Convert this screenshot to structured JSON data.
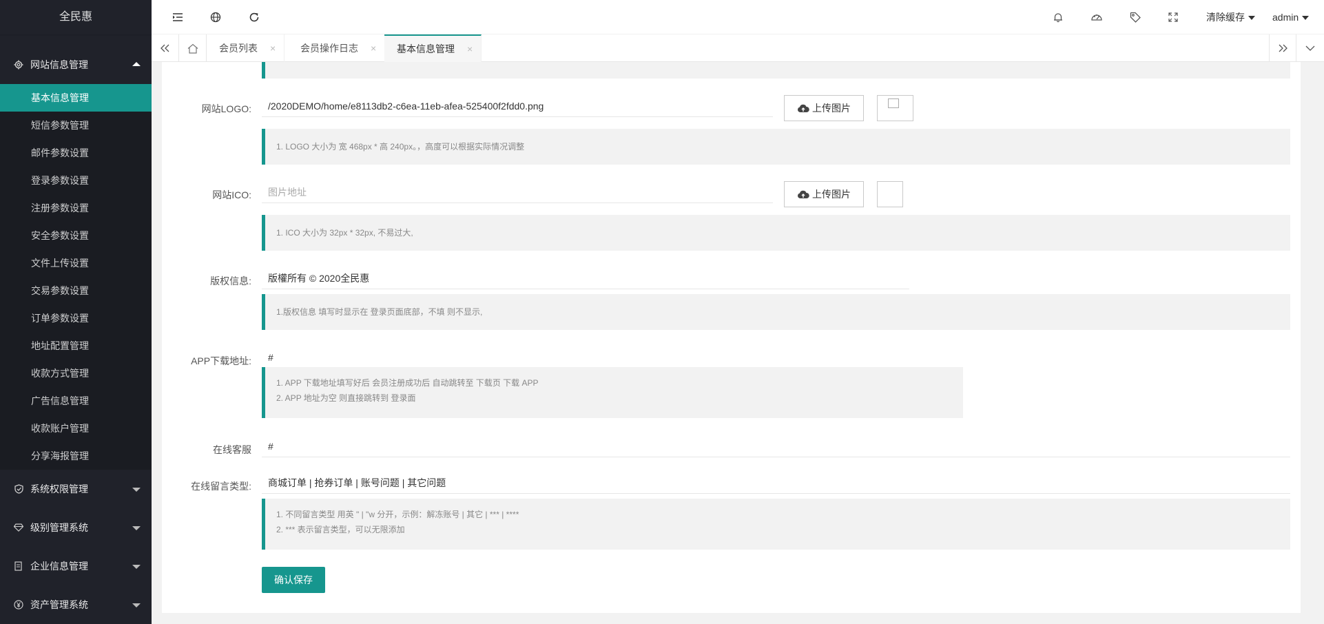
{
  "sidebar": {
    "logo": "全民惠",
    "groups": [
      {
        "label": "网站信息管理",
        "icon": "gear-icon",
        "expanded": true
      },
      {
        "label": "系统权限管理",
        "icon": "shield-icon"
      },
      {
        "label": "级别管理系统",
        "icon": "diamond-icon"
      },
      {
        "label": "企业信息管理",
        "icon": "doc-icon"
      },
      {
        "label": "资产管理系统",
        "icon": "yen-icon"
      }
    ],
    "submenu": [
      "基本信息管理",
      "短信参数管理",
      "邮件参数设置",
      "登录参数设置",
      "注册参数设置",
      "安全参数设置",
      "文件上传设置",
      "交易参数设置",
      "订单参数设置",
      "地址配置管理",
      "收款方式管理",
      "广告信息管理",
      "收款账户管理",
      "分享海报管理"
    ]
  },
  "header": {
    "clear_cache": "清除缓存",
    "user": "admin"
  },
  "tabs": [
    {
      "label": "会员列表"
    },
    {
      "label": "会员操作日志"
    },
    {
      "label": "基本信息管理",
      "active": true
    }
  ],
  "form": {
    "logo_label": "网站LOGO:",
    "logo_value": "/2020DEMO/home/e8113db2-c6ea-11eb-afea-525400f2fdd0.png",
    "upload_label": "上传图片",
    "logo_tip": "1. LOGO 大小为 宽 468px * 高 240px。，高度可以根据实际情况调整",
    "ico_label": "网站ICO:",
    "ico_placeholder": "图片地址",
    "ico_tip": "1. ICO 大小为 32px * 32px, 不易过大,",
    "copyright_label": "版权信息:",
    "copyright_value": "版權所有 © 2020全民惠",
    "copyright_tip": "1.版权信息 填写时显示在 登录页面底部，不填 则不显示,",
    "app_label": "APP下载地址:",
    "app_value": "#",
    "app_tip1": "1. APP 下载地址填写好后 会员注册成功后 自动跳转至 下载页 下载 APP",
    "app_tip2": "2. APP 地址为空 则直接跳转到 登录面",
    "service_label": "在线客服",
    "service_value": "#",
    "msg_label": "在线留言类型:",
    "msg_value": "商城订单 | 抢券订单 | 账号问题 | 其它问题",
    "msg_tip1": "1. 不同留言类型 用英 \" | \"w 分开，示例：解冻账号 | 其它 | *** | ****",
    "msg_tip2": "2. *** 表示留言类型，可以无限添加",
    "save_label": "确认保存"
  },
  "colors": {
    "accent": "#16968e",
    "sidebar": "#20222a"
  }
}
